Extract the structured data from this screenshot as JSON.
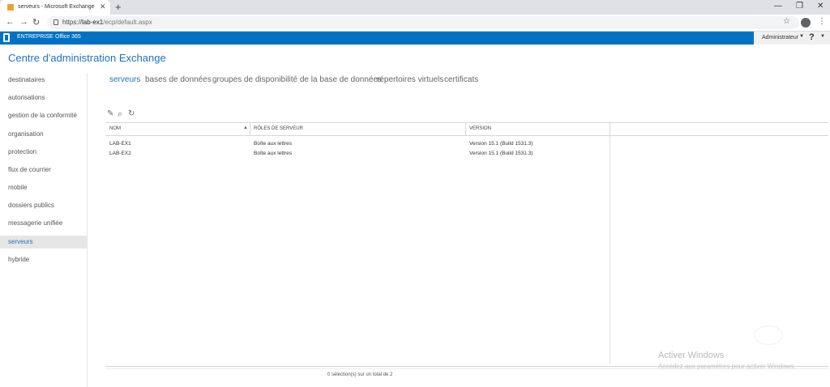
{
  "browser": {
    "tab_title": "serveurs - Microsoft Exchange",
    "tab_close": "✕",
    "new_tab": "+",
    "url_scheme": "https://",
    "url_host": "lab-ex1",
    "url_path": "/ecp/default.aspx",
    "controls": {
      "minimize": "—",
      "restore": "❐",
      "close": "✕"
    },
    "nav": {
      "back": "←",
      "forward": "→",
      "reload": "↻"
    },
    "star": "☆",
    "menu": "⋮"
  },
  "o365bar": {
    "enterprise": "ENTREPRISE",
    "office365": "Office 365",
    "admin": "Administrateur",
    "admin_caret": "▼",
    "help": "?",
    "help_caret": "▼",
    "color": "#0072c6"
  },
  "app": {
    "title": "Centre d'administration Exchange",
    "accent": "#1e73be"
  },
  "leftnav": {
    "items": [
      {
        "label": "destinataires"
      },
      {
        "label": "autorisations"
      },
      {
        "label": "gestion de la conformité"
      },
      {
        "label": "organisation"
      },
      {
        "label": "protection"
      },
      {
        "label": "flux de courrier"
      },
      {
        "label": "mobile"
      },
      {
        "label": "dossiers publics"
      },
      {
        "label": "messagerie unifiée"
      },
      {
        "label": "serveurs",
        "active": true
      },
      {
        "label": "hybride"
      }
    ]
  },
  "subnav": {
    "tabs": [
      {
        "label": "serveurs",
        "active": true
      },
      {
        "label": "bases de données"
      },
      {
        "label": "groupes de disponibilité de la base de données"
      },
      {
        "label": "répertoires virtuels"
      },
      {
        "label": "certificats"
      }
    ]
  },
  "toolbar": {
    "edit_icon": "✎",
    "search_icon": "⌕",
    "refresh_icon": "↻"
  },
  "grid": {
    "columns": [
      "NOM",
      "RÔLES DE SERVEUR",
      "VERSION"
    ],
    "sort_indicator": "▲",
    "rows": [
      [
        "LAB-EX1",
        "Boîte aux lettres",
        "Version 15.1 (Build 1531.3)"
      ],
      [
        "LAB-EX2",
        "Boîte aux lettres",
        "Version 15.1 (Build 1531.3)"
      ]
    ]
  },
  "status": "0 sélection(s) sur un total de 2",
  "watermark": {
    "title": "Activer Windows",
    "subtitle": "Accédez aux paramètres pour activer Windows."
  }
}
